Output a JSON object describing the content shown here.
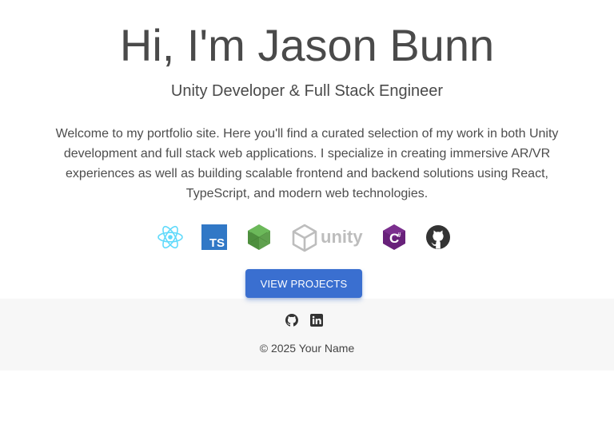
{
  "hero": {
    "title": "Hi, I'm Jason Bunn",
    "subtitle": "Unity Developer & Full Stack Engineer",
    "intro": "Welcome to my portfolio site. Here you'll find a curated selection of my work in both Unity development and full stack web applications. I specialize in creating immersive AR/VR experiences as well as building scalable frontend and backend solutions using React, TypeScript, and modern web technologies.",
    "tech_icons": [
      {
        "icon": "react-icon",
        "color": "#61dafb"
      },
      {
        "icon": "typescript-icon",
        "label": "TS",
        "color": "#3178c6"
      },
      {
        "icon": "nodejs-icon",
        "color": "#5fa04e"
      },
      {
        "icon": "unity-icon",
        "label": "unity",
        "color": "#bdbdbd"
      },
      {
        "icon": "csharp-icon",
        "label": "C#",
        "color": "#68217a"
      },
      {
        "icon": "github-icon",
        "color": "#333333"
      }
    ],
    "cta_label": "View Projects",
    "cta_color": "#3a6fd0"
  },
  "footer": {
    "links": [
      {
        "icon": "github-icon"
      },
      {
        "icon": "linkedin-icon"
      }
    ],
    "copyright": "© 2025 Your Name",
    "background": "#f7f7f7"
  }
}
